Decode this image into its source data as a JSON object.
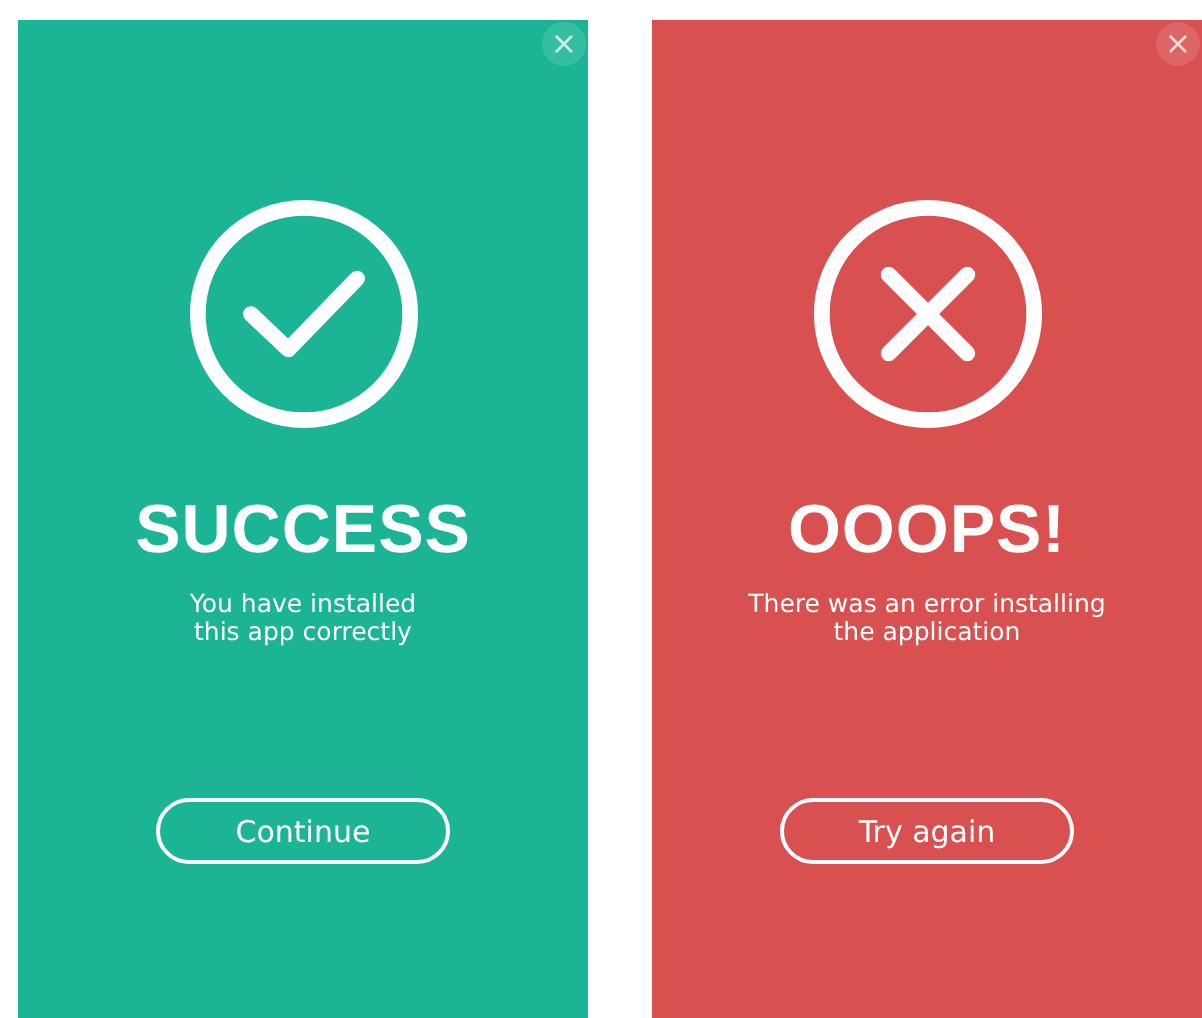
{
  "dialogs": [
    {
      "kind": "success",
      "close": "×",
      "title": "SUCCESS",
      "message_lines": [
        "You have installed",
        "this app correctly"
      ],
      "button": "Continue"
    },
    {
      "kind": "error",
      "close": "×",
      "title": "OOOPS!",
      "message_lines": [
        "There was an error installing",
        "the application"
      ],
      "button": "Try again"
    }
  ]
}
